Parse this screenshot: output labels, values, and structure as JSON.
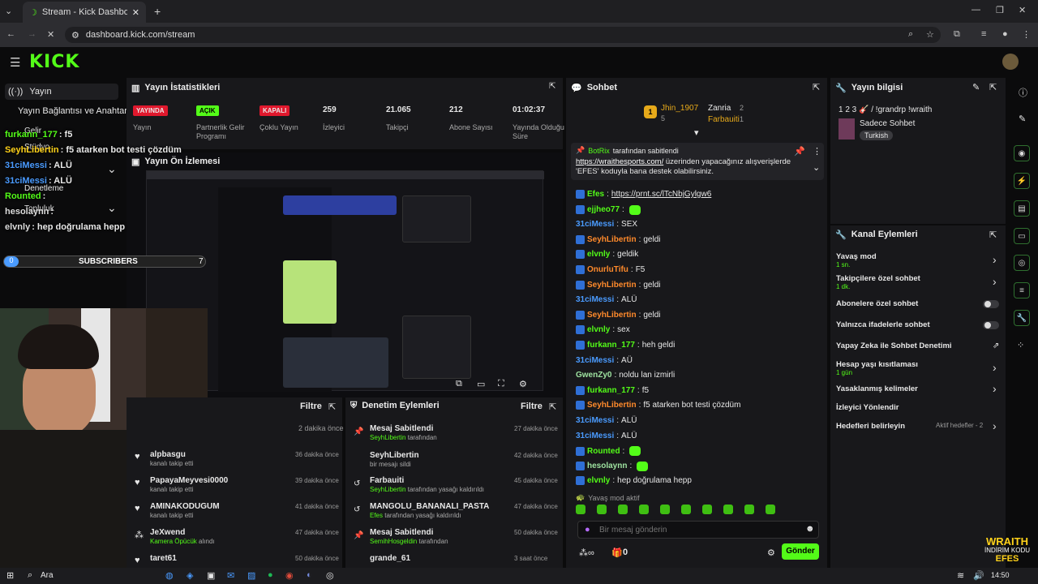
{
  "browser": {
    "tab_title": "Stream - Kick Dashboard",
    "url": "dashboard.kick.com/stream"
  },
  "sidebar": {
    "stream": "Yayın",
    "connections": "Yayın Bağlantısı ve Anahtarı",
    "income": "Gelir",
    "studio": "Stüdyo",
    "moderation": "Denetleme",
    "community": "Topluluk"
  },
  "overlay": {
    "chat": [
      {
        "user": "furkann_177",
        "text": ": f5"
      },
      {
        "user": "SeyhLibertin",
        "text": ": f5 atarken bot testi çözdüm"
      },
      {
        "user": "31ciMessi",
        "text": ": ALÜ"
      },
      {
        "user": "31ciMessi",
        "text": ": ALÜ"
      },
      {
        "user": "Rounted",
        "text": ":"
      },
      {
        "user": "hesolaynn",
        "text": ":"
      },
      {
        "user": "elvnly",
        "text": ": hep doğrulama hepp"
      }
    ],
    "subs_label": "SUBSCRIBERS",
    "subs_left": "0",
    "subs_right": "7",
    "brand_line1": "WRAITH",
    "brand_line2": "İNDİRİM KODU",
    "brand_line3": "EFES"
  },
  "stats": {
    "title": "Yayın İstatistikleri",
    "items": [
      {
        "value": "YAYINDA",
        "label": "Yayın"
      },
      {
        "value": "AÇIK",
        "label": "Partnerlik Gelir Programı"
      },
      {
        "value": "KAPALI",
        "label": "Çoklu Yayın"
      },
      {
        "value": "259",
        "label": "İzleyici"
      },
      {
        "value": "21.065",
        "label": "Takipçi"
      },
      {
        "value": "212",
        "label": "Abone Sayısı"
      },
      {
        "value": "01:02:37",
        "label": "Yayında Olduğu Süre"
      }
    ]
  },
  "preview": {
    "title": "Yayın Ön İzlemesi"
  },
  "activity": {
    "filter": "Filtre",
    "first_time": "2 dakika önce",
    "items": [
      {
        "name": "alpbasgu",
        "sub": "kanalı takip etti",
        "time": "36 dakika önce"
      },
      {
        "name": "PapayaMeyvesi0000",
        "sub": "kanalı takip etti",
        "time": "39 dakika önce"
      },
      {
        "name": "AMINAKODUGUM",
        "sub": "kanalı takip etti",
        "time": "41 dakika önce"
      },
      {
        "name": "JeXwend",
        "sub_hl": "Kamera Öpücük",
        "sub": "alındı",
        "time": "47 dakika önce"
      },
      {
        "name": "taret61",
        "sub": "",
        "time": "50 dakika önce"
      }
    ]
  },
  "modactions": {
    "title": "Denetim Eylemleri",
    "filter": "Filtre",
    "items": [
      {
        "name": "Mesaj Sabitlendi",
        "hl": "SeyhLibertin",
        "sub": "tarafından",
        "time": "27 dakika önce"
      },
      {
        "name": "SeyhLibertin",
        "hl": "",
        "sub": "bir mesajı sildi",
        "time": "42 dakika önce"
      },
      {
        "name": "Farbauiti",
        "hl": "SeyhLibertin",
        "sub": "tarafından yasağı kaldırıldı",
        "time": "45 dakika önce"
      },
      {
        "name": "MANGOLU_BANANALI_PASTA",
        "hl": "Efes",
        "sub": "tarafından yasağı kaldırıldı",
        "time": "47 dakika önce"
      },
      {
        "name": "Mesaj Sabitlendi",
        "hl": "SemihHosgeldin",
        "sub": "tarafından",
        "time": "50 dakika önce"
      },
      {
        "name": "grande_61",
        "hl": "",
        "sub": "",
        "time": "3 saat önce"
      }
    ]
  },
  "chat": {
    "title": "Sohbet",
    "top": [
      {
        "name": "Jhin_1907",
        "count": "5"
      },
      {
        "name": "Zanria",
        "count": "2"
      },
      {
        "name": "Farbauiti",
        "count": "1"
      }
    ],
    "pinned_by": "BotRix",
    "pinned_suffix": "tarafından sabitlendi",
    "pinned_link": "https://wraithesports.com/",
    "pinned_text": "üzerinden yapacağınız alışverişlerde 'EFES' koduyla bana destek olabilirsiniz.",
    "messages": [
      {
        "user": "Efes",
        "text": "https://prnt.sc/lTcNbjGylgw6",
        "color": "#53fc18"
      },
      {
        "user": "ejjheo77",
        "text": "",
        "color": "#53fc18"
      },
      {
        "user": "31ciMessi",
        "text": "SEX",
        "color": "#4a9bff"
      },
      {
        "user": "SeyhLibertin",
        "text": "geldi",
        "color": "#ff8a2b"
      },
      {
        "user": "elvnly",
        "text": "geldik",
        "color": "#53fc18"
      },
      {
        "user": "OnurluTifu",
        "text": "F5",
        "color": "#ff8a2b"
      },
      {
        "user": "SeyhLibertin",
        "text": "geldi",
        "color": "#ff8a2b"
      },
      {
        "user": "31ciMessi",
        "text": "ALÜ",
        "color": "#4a9bff"
      },
      {
        "user": "SeyhLibertin",
        "text": "geldi",
        "color": "#ff8a2b"
      },
      {
        "user": "elvnly",
        "text": "sex",
        "color": "#53fc18"
      },
      {
        "user": "furkann_177",
        "text": "heh geldi",
        "color": "#53fc18"
      },
      {
        "user": "31ciMessi",
        "text": "AÜ",
        "color": "#4a9bff"
      },
      {
        "user": "GwenZy0",
        "text": "noldu lan izmirli",
        "color": "#9ee2a0"
      },
      {
        "user": "furkann_177",
        "text": "f5",
        "color": "#53fc18"
      },
      {
        "user": "SeyhLibertin",
        "text": "f5 atarken bot testi çözdüm",
        "color": "#ff8a2b"
      },
      {
        "user": "31ciMessi",
        "text": "ALÜ",
        "color": "#4a9bff"
      },
      {
        "user": "31ciMessi",
        "text": "ALÜ",
        "color": "#4a9bff"
      },
      {
        "user": "Rounted",
        "text": "",
        "color": "#53fc18"
      },
      {
        "user": "hesolaynn",
        "text": "",
        "color": "#9ee2a0"
      },
      {
        "user": "elvnly",
        "text": "hep doğrulama hepp",
        "color": "#53fc18"
      }
    ],
    "slow_notice": "Yavaş mod aktif",
    "placeholder": "Bir mesaj gönderin",
    "zero": "0",
    "send": "Gönder"
  },
  "info": {
    "title": "Yayın bilgisi",
    "stream_title": "1 2 3 🎸 / !grandrp !wraith",
    "category": "Sadece Sohbet",
    "language": "Turkish"
  },
  "actions": {
    "title": "Kanal Eylemleri",
    "items": [
      {
        "label": "Yavaş mod",
        "sub": "1 sn."
      },
      {
        "label": "Takipçilere özel sohbet",
        "sub": "1 dk."
      },
      {
        "label": "Abonelere özel sohbet",
        "sub": ""
      },
      {
        "label": "Yalnızca ifadelerle sohbet",
        "sub": ""
      },
      {
        "label": "Yapay Zeka ile Sohbet Denetimi",
        "sub": ""
      },
      {
        "label": "Hesap yaşı kısıtlaması",
        "sub": "1 gün"
      },
      {
        "label": "Yasaklanmış kelimeler",
        "sub": ""
      },
      {
        "label": "İzleyici Yönlendir",
        "sub": ""
      },
      {
        "label": "Hedefleri belirleyin",
        "sub": ""
      }
    ],
    "goals_status": "Aktif hedefler - 2"
  },
  "taskbar": {
    "search": "Ara",
    "time": "14:50"
  },
  "colors": {
    "kick_green": "#53fc18",
    "live_red": "#e0182d"
  }
}
